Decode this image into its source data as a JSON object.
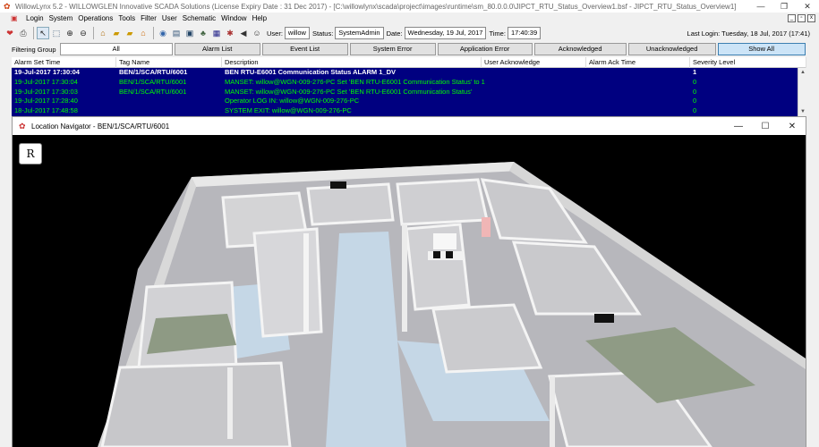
{
  "app": {
    "title": "WillowLynx 5.2 - WILLOWGLEN Innovative SCADA Solutions (License Expiry Date : 31 Dec 2017) - [C:\\willowlynx\\scada\\project\\images\\runtime\\sm_80.0.0.0\\JIPCT_RTU_Status_Overview1.bsf - JIPCT_RTU_Status_Overview1]",
    "window_controls": [
      "—",
      "❐",
      "✕"
    ]
  },
  "menu": {
    "items": [
      "Login",
      "System",
      "Operations",
      "Tools",
      "Filter",
      "User",
      "Schematic",
      "Window",
      "Help"
    ],
    "mdi_controls": [
      "_",
      "▫",
      "x"
    ]
  },
  "toolbar": {
    "user_label": "User:",
    "user_value": "willow",
    "status_label": "Status:",
    "status_value": "SystemAdmin",
    "date_label": "Date:",
    "date_value": "Wednesday, 19 Jul, 2017",
    "time_label": "Time:",
    "time_value": "17:40:39",
    "last_login": "Last Login: Tuesday, 18 Jul, 2017 (17:41)"
  },
  "filter": {
    "label": "Filtering Group",
    "buttons": [
      "All",
      "Alarm List",
      "Event List",
      "System Error",
      "Application Error",
      "Acknowledged",
      "Unacknowledged",
      "Show All"
    ],
    "active": "Show All"
  },
  "alarms": {
    "columns": [
      "Alarm Set Time",
      "Tag Name",
      "Description",
      "User Acknowledge",
      "Alarm Ack Time",
      "Severity Level"
    ],
    "rows": [
      {
        "time": "19-Jul-2017 17:30:04",
        "tag": "BEN/1/SCA/RTU/6001",
        "desc": "BEN RTU-E6001 Communication Status ALARM 1_DV",
        "user": "",
        "ack": "",
        "sev": "1"
      },
      {
        "time": "19-Jul-2017 17:30:04",
        "tag": "BEN/1/SCA/RTU/6001",
        "desc": "MANSET: willow@WGN-009-276-PC Set 'BEN RTU-E6001 Communication Status' to 1",
        "user": "",
        "ack": "",
        "sev": "0"
      },
      {
        "time": "19-Jul-2017 17:30:03",
        "tag": "BEN/1/SCA/RTU/6001",
        "desc": "MANSET: willow@WGN-009-276-PC Set 'BEN RTU-E6001 Communication Status'",
        "user": "",
        "ack": "",
        "sev": "0"
      },
      {
        "time": "19-Jul-2017 17:28:40",
        "tag": "",
        "desc": "Operator LOG IN: willow@WGN-009-276-PC",
        "user": "",
        "ack": "",
        "sev": "0"
      },
      {
        "time": "18-Jul-2017 17:48:58",
        "tag": "",
        "desc": "SYSTEM EXIT: willow@WGN-009-276-PC",
        "user": "",
        "ack": "",
        "sev": "0"
      }
    ]
  },
  "navigator": {
    "title": "Location Navigator - BEN/1/SCA/RTU/6001",
    "controls": [
      "—",
      "☐",
      "✕"
    ],
    "reset_label": "R"
  }
}
